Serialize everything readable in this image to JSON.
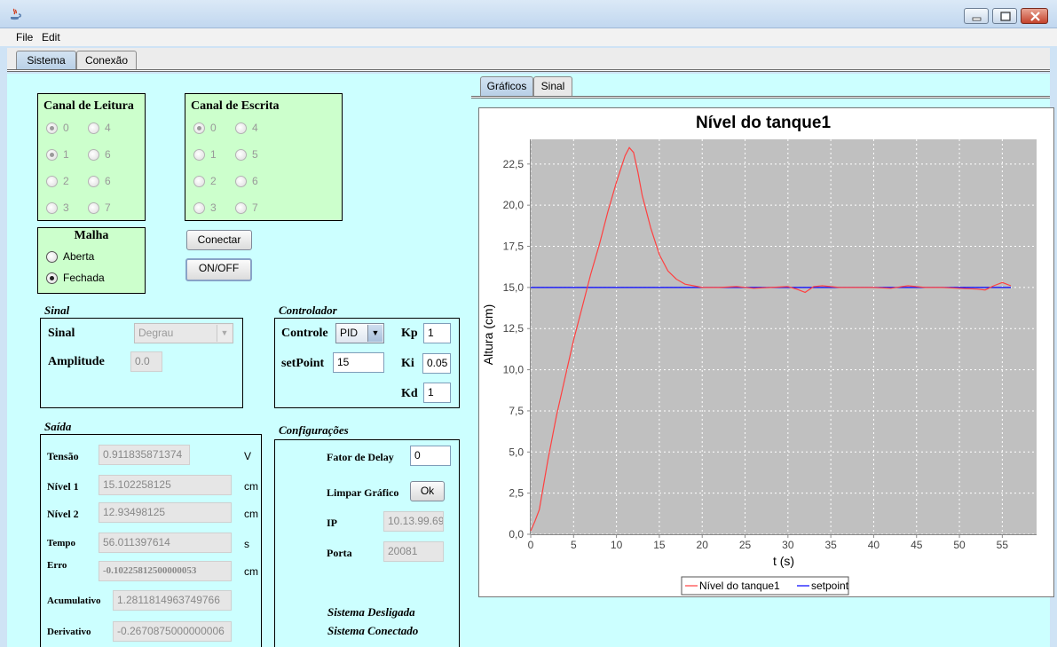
{
  "menu": {
    "file": "File",
    "edit": "Edit"
  },
  "main_tabs": [
    {
      "label": "Sistema"
    },
    {
      "label": "Conexão"
    }
  ],
  "chart_tabs": [
    {
      "label": "Gráficos"
    },
    {
      "label": "Sinal"
    }
  ],
  "canal_leitura": {
    "title": "Canal de Leitura",
    "options": [
      "0",
      "4",
      "1",
      "6",
      "2",
      "6",
      "3",
      "7"
    ],
    "selected": [
      "0",
      "1"
    ]
  },
  "canal_escrita": {
    "title": "Canal de Escrita",
    "options": [
      "0",
      "4",
      "1",
      "5",
      "2",
      "6",
      "3",
      "7"
    ],
    "selected": [
      "0"
    ]
  },
  "malha": {
    "title": "Malha",
    "options": [
      "Aberta",
      "Fechada"
    ],
    "selected": "Fechada"
  },
  "buttons": {
    "conectar": "Conectar",
    "onoff": "ON/OFF",
    "ok": "Ok"
  },
  "sinal": {
    "section_title": "Sinal",
    "sinal_label": "Sinal",
    "sinal_value": "Degrau",
    "amplitude_label": "Amplitude",
    "amplitude_value": "0.0"
  },
  "controlador": {
    "section_title": "Controlador",
    "controle_label": "Controle",
    "controle_value": "PID",
    "setpoint_label": "setPoint",
    "setpoint_value": "15",
    "kp_label": "Kp",
    "kp_value": "1",
    "ki_label": "Ki",
    "ki_value": "0.05",
    "kd_label": "Kd",
    "kd_value": "1"
  },
  "saida": {
    "section_title": "Saída",
    "rows": [
      {
        "label": "Tensão",
        "value": "0.911835871374",
        "unit": "V"
      },
      {
        "label": "Nível 1",
        "value": "15.102258125",
        "unit": "cm"
      },
      {
        "label": "Nível 2",
        "value": "12.93498125",
        "unit": "cm"
      },
      {
        "label": "Tempo",
        "value": "56.011397614",
        "unit": "s"
      },
      {
        "label": "Erro",
        "value": "-0.10225812500000053",
        "unit": "cm"
      },
      {
        "label": "Acumulativo",
        "value": "1.2811814963749766",
        "unit": ""
      },
      {
        "label": "Derivativo",
        "value": "-0.2670875000000006",
        "unit": ""
      }
    ]
  },
  "configuracoes": {
    "section_title": "Configurações",
    "delay_label": "Fator de Delay",
    "delay_value": "0",
    "limpar_label": "Limpar Gráfico",
    "ip_label": "IP",
    "ip_value": "10.13.99.69",
    "porta_label": "Porta",
    "porta_value": "20081",
    "status_1": "Sistema Desligada",
    "status_2": "Sistema Conectado"
  },
  "chart_data": {
    "type": "line",
    "title": "Nível do tanque1",
    "xlabel": "t (s)",
    "ylabel": "Altura (cm)",
    "xlim": [
      0,
      59
    ],
    "ylim": [
      0,
      24
    ],
    "xticks": [
      0,
      5,
      10,
      15,
      20,
      25,
      30,
      35,
      40,
      45,
      50,
      55
    ],
    "yticks": [
      "0,0",
      "2,5",
      "5,0",
      "7,5",
      "10,0",
      "12,5",
      "15,0",
      "17,5",
      "20,0",
      "22,5"
    ],
    "ytick_values": [
      0,
      2.5,
      5,
      7.5,
      10,
      12.5,
      15,
      17.5,
      20,
      22.5
    ],
    "grid": true,
    "legend": "bottom",
    "series": [
      {
        "name": "Nível do tanque1",
        "color": "#ff4040",
        "x": [
          0,
          0.5,
          1,
          1.5,
          2,
          3,
          4,
          5,
          6,
          7,
          8,
          9,
          10,
          11,
          11.5,
          12,
          12.5,
          13,
          14,
          15,
          16,
          17,
          18,
          19,
          20,
          22,
          24,
          26,
          28,
          30,
          31,
          32,
          33,
          34,
          36,
          38,
          40,
          42,
          44,
          46,
          48,
          50,
          52,
          53,
          54,
          55,
          56
        ],
        "y": [
          0.2,
          0.8,
          1.5,
          3.0,
          4.5,
          7.2,
          9.5,
          11.8,
          13.8,
          15.8,
          17.6,
          19.6,
          21.4,
          23.0,
          23.5,
          23.2,
          22.0,
          20.6,
          18.6,
          17.0,
          16.0,
          15.5,
          15.2,
          15.1,
          15.0,
          15.0,
          15.05,
          14.95,
          15.0,
          15.05,
          14.9,
          14.7,
          15.05,
          15.1,
          15.0,
          15.0,
          15.0,
          14.95,
          15.1,
          15.0,
          15.0,
          14.95,
          14.9,
          14.85,
          15.1,
          15.3,
          15.1
        ]
      },
      {
        "name": "setpoint",
        "color": "#0000ff",
        "x": [
          0,
          56
        ],
        "y": [
          15,
          15
        ]
      }
    ]
  }
}
